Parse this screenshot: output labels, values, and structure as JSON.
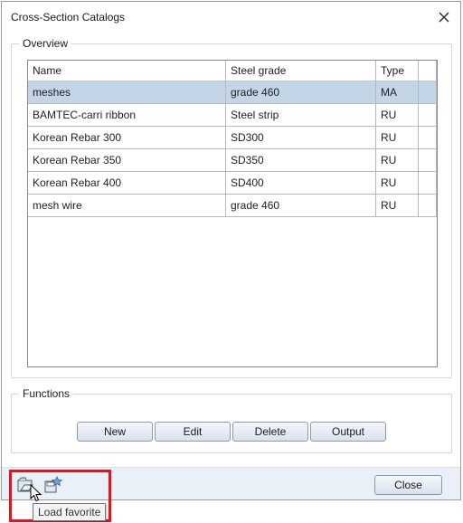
{
  "window": {
    "title": "Cross-Section Catalogs"
  },
  "overview": {
    "legend": "Overview",
    "columns": [
      "Name",
      "Steel grade",
      "Type"
    ],
    "rows": [
      {
        "name": "meshes",
        "grade": "grade 460",
        "type": "MA",
        "selected": true
      },
      {
        "name": "BAMTEC-carri ribbon",
        "grade": "Steel strip",
        "type": "RU"
      },
      {
        "name": "Korean Rebar 300",
        "grade": "SD300",
        "type": "RU"
      },
      {
        "name": "Korean Rebar 350",
        "grade": "SD350",
        "type": "RU"
      },
      {
        "name": "Korean Rebar 400",
        "grade": "SD400",
        "type": "RU"
      },
      {
        "name": "mesh wire",
        "grade": "grade 460",
        "type": "RU"
      }
    ]
  },
  "functions": {
    "legend": "Functions",
    "buttons": {
      "new": "New",
      "edit": "Edit",
      "delete": "Delete",
      "output": "Output"
    }
  },
  "footer": {
    "close_label": "Close",
    "tooltip": "Load favorite",
    "icons": [
      "load-favorite-icon",
      "save-favorite-icon"
    ]
  },
  "colors": {
    "selected_row": "#c5d5e8",
    "highlight_box": "#e8121b",
    "footer_bg": "#eaf0f7"
  }
}
